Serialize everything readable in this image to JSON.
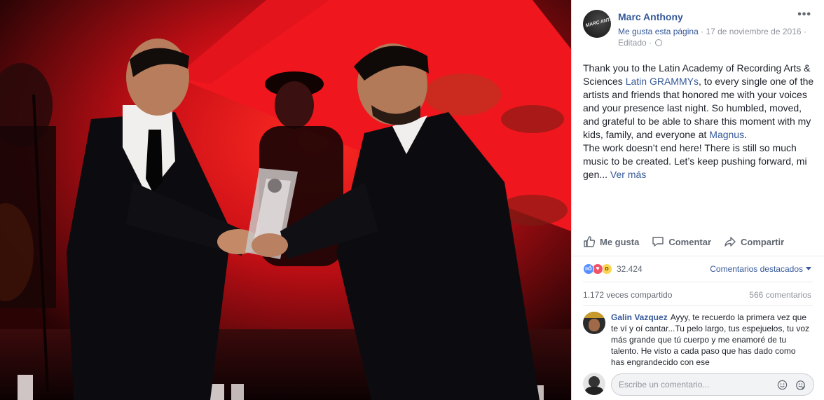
{
  "post": {
    "author": "Marc Anthony",
    "avatar_logo": "MARC ANTHONY",
    "like_page_label": "Me gusta esta página",
    "date": "17 de noviembre de 2016",
    "edited_label": "Editado",
    "more_label": "•••",
    "text": {
      "part1": "Thank you to the Latin Academy of Recording Arts & Sciences ",
      "link1": "Latin GRAMMYs",
      "part2": ", to every single one of the artists and friends that honored me with your voices and your presence last night. So humbled, moved, and grateful to be able to share this moment with my kids, family, and everyone at ",
      "link2": "Magnus",
      "part3": ".",
      "part4": "The work doesn’t end here! There is still so much music to be created. Let’s keep pushing forward, mi gen...",
      "see_more": "Ver más"
    }
  },
  "actions": {
    "like": "Me gusta",
    "comment": "Comentar",
    "share": "Compartir"
  },
  "reactions": {
    "count": "32.424",
    "types": [
      "like-icon",
      "love-icon",
      "wow-icon"
    ]
  },
  "comments_sort": "Comentarios destacados",
  "stats": {
    "shares": "1.172 veces compartido",
    "comments": "566 comentarios"
  },
  "top_comment": {
    "author": "Galin Vazquez",
    "text": "Ayyy, te recuerdo la primera vez que te ví y oí cantar...Tu pelo largo, tus espejuelos, tu voz más grande que tú cuerpo y me enamoré de tu talento. He visto a cada paso que has dado como has engrandecido con ese"
  },
  "reply_box": {
    "placeholder": "Escribe un comentario..."
  },
  "colors": {
    "link": "#365899",
    "meta": "#90949c",
    "stage_red": "#e4141c"
  }
}
